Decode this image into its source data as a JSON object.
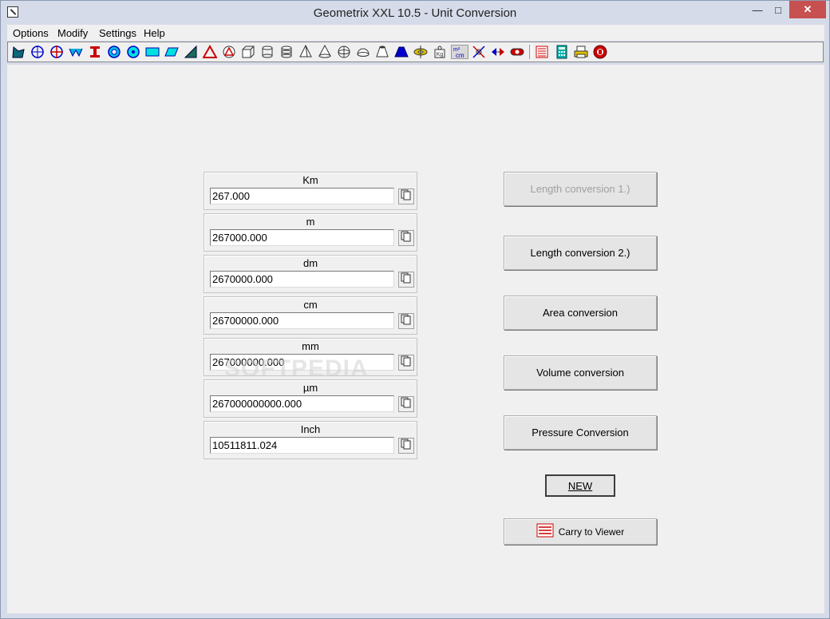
{
  "window": {
    "title": "Geometrix XXL 10.5 - Unit Conversion",
    "minimize_glyph": "—",
    "maximize_glyph": "□",
    "close_glyph": "✕"
  },
  "menu": {
    "items": [
      {
        "label": "Options"
      },
      {
        "label": "Modify"
      },
      {
        "label": "Settings"
      },
      {
        "label": "Help"
      }
    ]
  },
  "toolbar": {
    "icons": [
      "polygon-icon",
      "circle-crosshair-icon",
      "circle-crosshair-red-icon",
      "trapezoid-icon",
      "ibeam-icon",
      "ring-icon",
      "ring-cyan-icon",
      "rectangle-icon",
      "parallelogram-icon",
      "right-triangle-icon",
      "triangle-icon",
      "triangle-circle-icon",
      "cube-icon",
      "cylinder-icon",
      "cylinder-cut-icon",
      "pyramid-icon",
      "cone-icon",
      "sphere-icon",
      "sphere-segment-icon",
      "frustum-icon",
      "frustum-blue-icon",
      "torus-icon",
      "weight-icon",
      "unit-conversion-icon",
      "angles-icon",
      "arrows-icon",
      "capsule-icon",
      "list-icon",
      "calculator-icon",
      "printer-icon",
      "exit-icon"
    ]
  },
  "units": [
    {
      "label": "Km",
      "value": "267.000"
    },
    {
      "label": "m",
      "value": "267000.000"
    },
    {
      "label": "dm",
      "value": "2670000.000"
    },
    {
      "label": "cm",
      "value": "26700000.000"
    },
    {
      "label": "mm",
      "value": "267000000.000"
    },
    {
      "label": "µm",
      "value": "267000000000.000"
    },
    {
      "label": "Inch",
      "value": "10511811.024"
    }
  ],
  "buttons": {
    "length1": "Length conversion 1.)",
    "length2": "Length conversion 2.)",
    "area": "Area conversion",
    "volume": "Volume conversion",
    "pressure": "Pressure Conversion",
    "new": "NEW",
    "carry": "Carry to Viewer"
  },
  "watermark": "SOFTPEDIA",
  "colors": {
    "close_button": "#c75050",
    "toolbar_cyan": "#00e0e0",
    "toolbar_blue": "#0000cc",
    "toolbar_red": "#cc0000",
    "disabled_text": "#a0a0a0"
  }
}
